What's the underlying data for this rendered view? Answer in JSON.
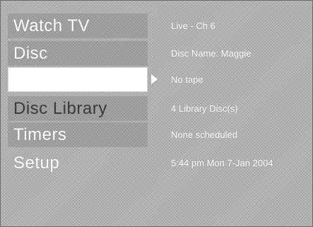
{
  "menu": {
    "items": [
      {
        "label": "Watch TV",
        "info": "Live - Ch 6"
      },
      {
        "label": "Disc",
        "info": "Disc Name: Maggie"
      },
      {
        "label": "",
        "info": "No tape"
      },
      {
        "label": "Disc Library",
        "info": "4 Library Disc(s)"
      },
      {
        "label": "Timers",
        "info": "None scheduled"
      },
      {
        "label": "Setup",
        "info": "5:44 pm Mon 7-Jan 2004"
      }
    ],
    "selected_index": 2
  },
  "icons": {
    "selection_indicator": "right-arrow-icon"
  },
  "colors": {
    "background": "#b3b3b3",
    "selected_row": "#ffffff",
    "text": "#ffffff",
    "dark_text": "#3a3a3a"
  }
}
